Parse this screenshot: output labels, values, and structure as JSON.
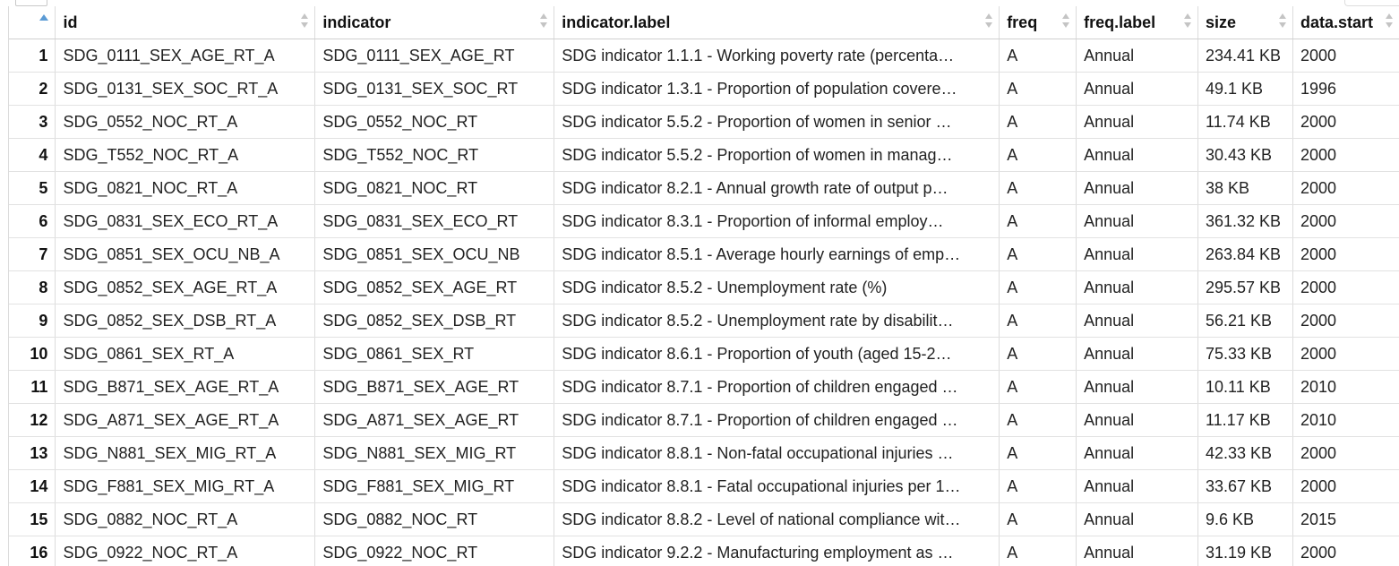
{
  "columns": [
    "",
    "id",
    "indicator",
    "indicator.label",
    "freq",
    "freq.label",
    "size",
    "data.start"
  ],
  "rows": [
    [
      "1",
      "SDG_0111_SEX_AGE_RT_A",
      "SDG_0111_SEX_AGE_RT",
      "SDG indicator 1.1.1 - Working poverty rate (percenta…",
      "A",
      "Annual",
      "234.41 KB",
      "2000"
    ],
    [
      "2",
      "SDG_0131_SEX_SOC_RT_A",
      "SDG_0131_SEX_SOC_RT",
      "SDG indicator 1.3.1 - Proportion of population covere…",
      "A",
      "Annual",
      "49.1 KB",
      "1996"
    ],
    [
      "3",
      "SDG_0552_NOC_RT_A",
      "SDG_0552_NOC_RT",
      "SDG indicator 5.5.2 - Proportion of women in senior …",
      "A",
      "Annual",
      "11.74 KB",
      "2000"
    ],
    [
      "4",
      "SDG_T552_NOC_RT_A",
      "SDG_T552_NOC_RT",
      "SDG indicator 5.5.2 - Proportion of women in manag…",
      "A",
      "Annual",
      "30.43 KB",
      "2000"
    ],
    [
      "5",
      "SDG_0821_NOC_RT_A",
      "SDG_0821_NOC_RT",
      "SDG indicator 8.2.1 - Annual growth rate of output p…",
      "A",
      "Annual",
      "38 KB",
      "2000"
    ],
    [
      "6",
      "SDG_0831_SEX_ECO_RT_A",
      "SDG_0831_SEX_ECO_RT",
      "SDG indicator 8.3.1 - Proportion of informal employ…",
      "A",
      "Annual",
      "361.32 KB",
      "2000"
    ],
    [
      "7",
      "SDG_0851_SEX_OCU_NB_A",
      "SDG_0851_SEX_OCU_NB",
      "SDG indicator 8.5.1 - Average hourly earnings of emp…",
      "A",
      "Annual",
      "263.84 KB",
      "2000"
    ],
    [
      "8",
      "SDG_0852_SEX_AGE_RT_A",
      "SDG_0852_SEX_AGE_RT",
      "SDG indicator 8.5.2 - Unemployment rate (%)",
      "A",
      "Annual",
      "295.57 KB",
      "2000"
    ],
    [
      "9",
      "SDG_0852_SEX_DSB_RT_A",
      "SDG_0852_SEX_DSB_RT",
      "SDG indicator 8.5.2 - Unemployment rate by disabilit…",
      "A",
      "Annual",
      "56.21 KB",
      "2000"
    ],
    [
      "10",
      "SDG_0861_SEX_RT_A",
      "SDG_0861_SEX_RT",
      "SDG indicator 8.6.1 - Proportion of youth (aged 15-2…",
      "A",
      "Annual",
      "75.33 KB",
      "2000"
    ],
    [
      "11",
      "SDG_B871_SEX_AGE_RT_A",
      "SDG_B871_SEX_AGE_RT",
      "SDG indicator 8.7.1 - Proportion of children engaged …",
      "A",
      "Annual",
      "10.11 KB",
      "2010"
    ],
    [
      "12",
      "SDG_A871_SEX_AGE_RT_A",
      "SDG_A871_SEX_AGE_RT",
      "SDG indicator 8.7.1 - Proportion of children engaged …",
      "A",
      "Annual",
      "11.17 KB",
      "2010"
    ],
    [
      "13",
      "SDG_N881_SEX_MIG_RT_A",
      "SDG_N881_SEX_MIG_RT",
      "SDG indicator 8.8.1 - Non-fatal occupational injuries …",
      "A",
      "Annual",
      "42.33 KB",
      "2000"
    ],
    [
      "14",
      "SDG_F881_SEX_MIG_RT_A",
      "SDG_F881_SEX_MIG_RT",
      "SDG indicator 8.8.1 - Fatal occupational injuries per 1…",
      "A",
      "Annual",
      "33.67 KB",
      "2000"
    ],
    [
      "15",
      "SDG_0882_NOC_RT_A",
      "SDG_0882_NOC_RT",
      "SDG indicator 8.8.2 - Level of national compliance wit…",
      "A",
      "Annual",
      "9.6 KB",
      "2015"
    ],
    [
      "16",
      "SDG_0922_NOC_RT_A",
      "SDG_0922_NOC_RT",
      "SDG indicator 9.2.2 - Manufacturing employment as …",
      "A",
      "Annual",
      "31.19 KB",
      "2000"
    ]
  ]
}
